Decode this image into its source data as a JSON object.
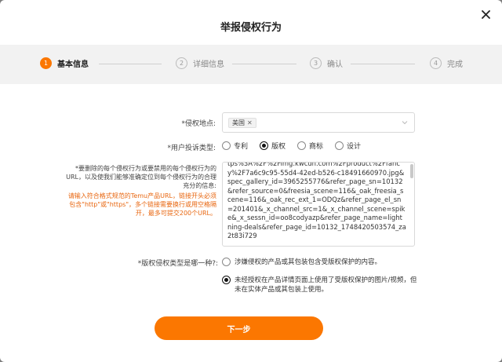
{
  "dialog": {
    "title": "举报侵权行为",
    "close_icon": "close-icon"
  },
  "steps": [
    {
      "num": "1",
      "label": "基本信息",
      "active": true
    },
    {
      "num": "2",
      "label": "详细信息",
      "active": false
    },
    {
      "num": "3",
      "label": "确认",
      "active": false
    },
    {
      "num": "4",
      "label": "完成",
      "active": false
    }
  ],
  "form": {
    "location": {
      "label": "*侵权地点:",
      "tag": "美国"
    },
    "complaint_type": {
      "label": "*用户投诉类型:",
      "options": [
        "专利",
        "版权",
        "商标",
        "设计"
      ],
      "selected": "版权"
    },
    "urls": {
      "description": "*要删除的每个侵权行为或要禁用的每个侵权行为的URL，以及使我们能够准确定位到每个侵权行为的合理充分的信息:",
      "hint": "请输入符合格式规范的Temu产品URL，链接开头必须包含\"http\"或\"https\"，多个链接需要换行或用空格隔开，最多可提交200个URL。",
      "value": "tps%3A%2F%2Fimg.kwcdn.com%2Fproduct%2Ffancy%2F7a6c9c95-55d4-42ed-b526-c18491660970.jpg&spec_gallery_id=3965255776&refer_page_sn=10132&refer_source=0&freesia_scene=116&_oak_freesia_scene=116&_oak_rec_ext_1=ODQz&refer_page_el_sn=201401&_x_channel_src=1&_x_channel_scene=spike&_x_sessn_id=oo8codyazp&refer_page_name=lightning-deals&refer_page_id=10132_1748420503574_za2t83i729"
    },
    "copyright_type": {
      "label": "*版权侵权类型是哪一种?:",
      "options": [
        "涉嫌侵权的产品或其包装包含受版权保护的内容。",
        "未经授权在产品详情页面上使用了受版权保护的图片/视频，但未在实体产品或其包装上使用。"
      ],
      "selected": 1
    }
  },
  "submit_label": "下一步",
  "colors": {
    "accent": "#fb7701",
    "hint": "#e8660f"
  }
}
